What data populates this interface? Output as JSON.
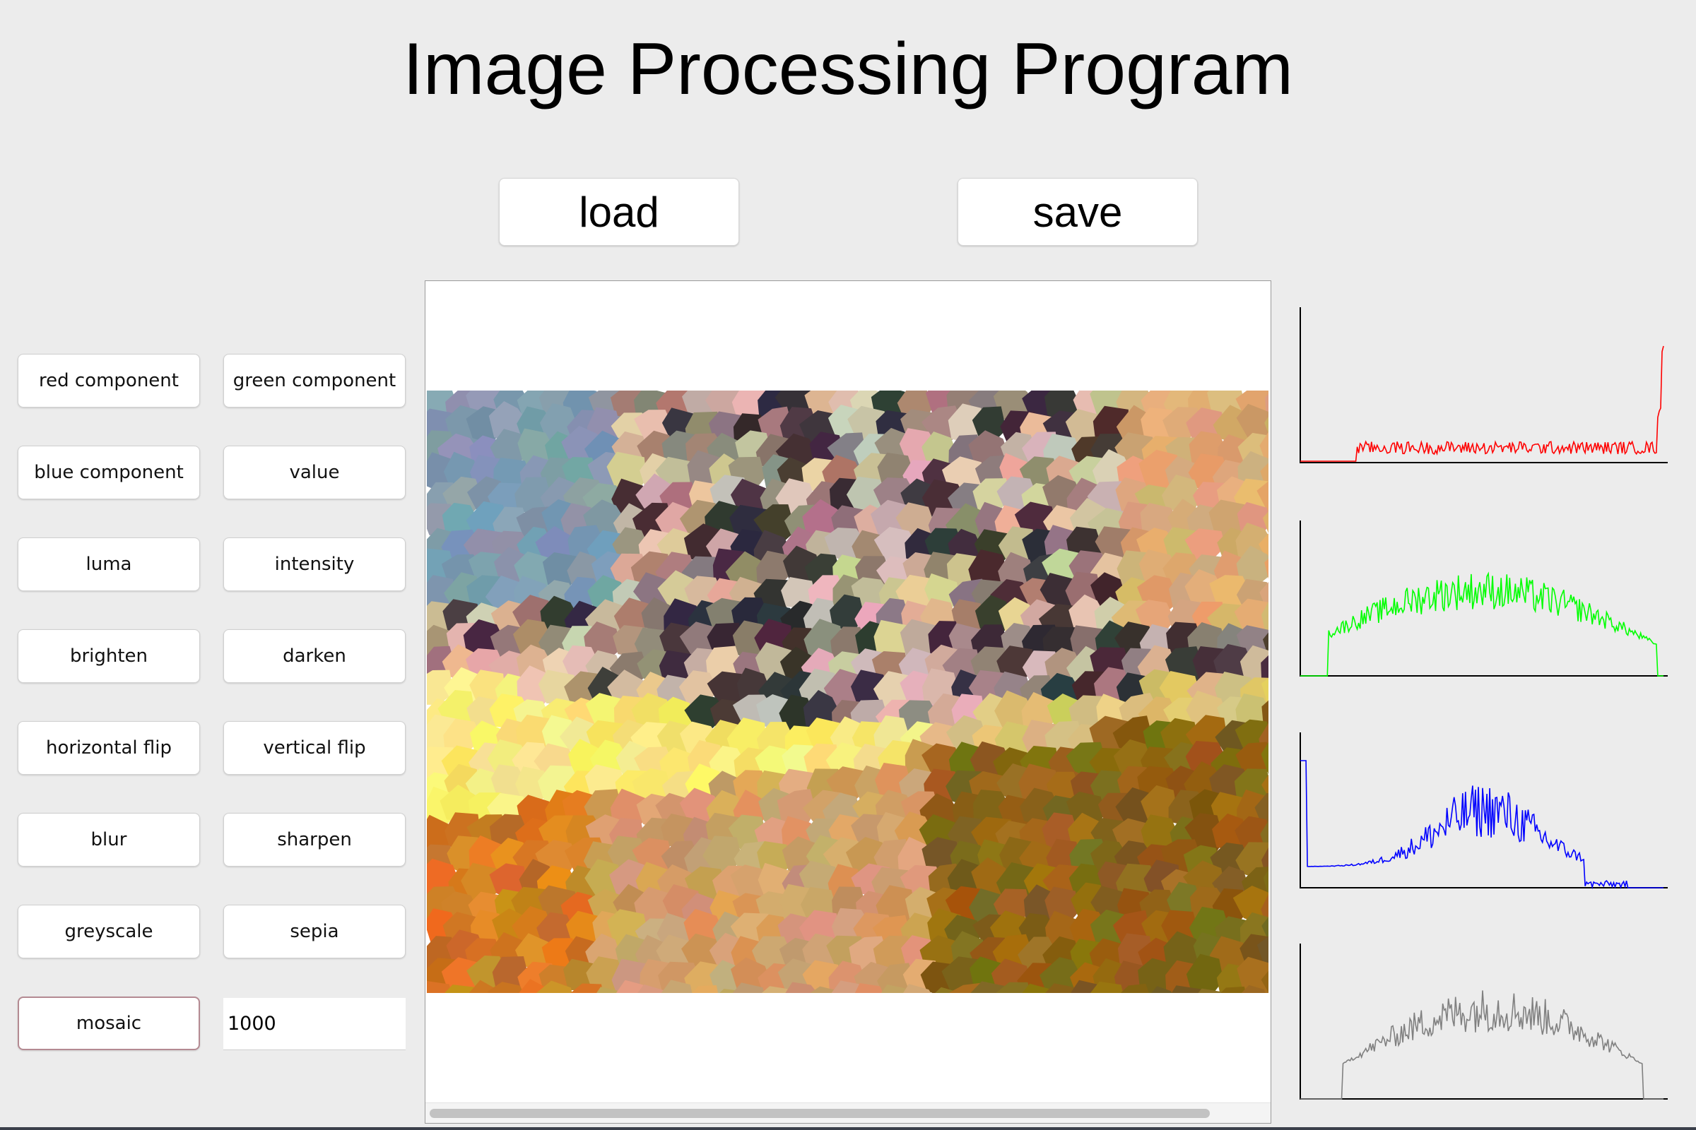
{
  "app": {
    "title": "Image Processing Program"
  },
  "toolbar": {
    "load_label": "load",
    "save_label": "save"
  },
  "operations": [
    [
      "red component",
      "green component"
    ],
    [
      "blue component",
      "value"
    ],
    [
      "luma",
      "intensity"
    ],
    [
      "brighten",
      "darken"
    ],
    [
      "horizontal flip",
      "vertical flip"
    ],
    [
      "blur",
      "sharpen"
    ],
    [
      "greyscale",
      "sepia"
    ]
  ],
  "mosaic": {
    "label": "mosaic",
    "seeds_value": "1000"
  },
  "histograms": [
    {
      "channel": "red",
      "color": "#ff0000"
    },
    {
      "channel": "green",
      "color": "#00ff00"
    },
    {
      "channel": "blue",
      "color": "#0000ff"
    },
    {
      "channel": "intensity",
      "color": "#808080"
    }
  ]
}
